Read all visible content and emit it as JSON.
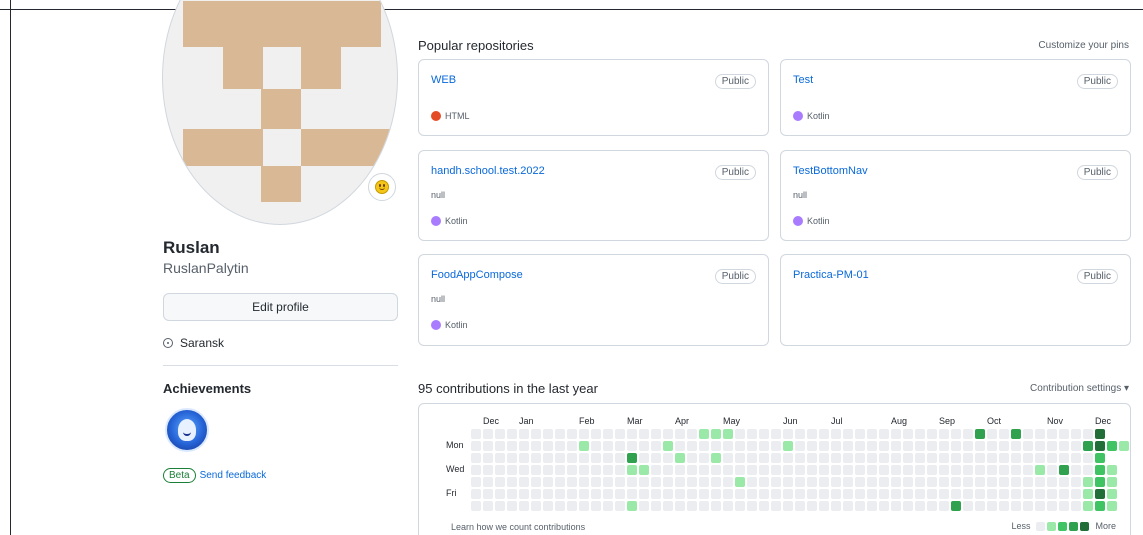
{
  "profile": {
    "name": "Ruslan",
    "login": "RuslanPalytin",
    "edit_label": "Edit profile",
    "location": "Saransk",
    "achievements_title": "Achievements",
    "beta_label": "Beta",
    "feedback_label": "Send feedback"
  },
  "repos": {
    "title": "Popular repositories",
    "customize_label": "Customize your pins",
    "items": [
      {
        "name": "WEB",
        "visibility": "Public",
        "description": "",
        "language": "HTML",
        "color": "#e34c26"
      },
      {
        "name": "Test",
        "visibility": "Public",
        "description": "",
        "language": "Kotlin",
        "color": "#A97BFF"
      },
      {
        "name": "handh.school.test.2022",
        "visibility": "Public",
        "description": "null",
        "language": "Kotlin",
        "color": "#A97BFF"
      },
      {
        "name": "TestBottomNav",
        "visibility": "Public",
        "description": "null",
        "language": "Kotlin",
        "color": "#A97BFF"
      },
      {
        "name": "FoodAppCompose",
        "visibility": "Public",
        "description": "null",
        "language": "Kotlin",
        "color": "#A97BFF"
      },
      {
        "name": "Practica-PM-01",
        "visibility": "Public",
        "description": "",
        "language": "",
        "color": ""
      }
    ]
  },
  "contributions": {
    "title": "95 contributions in the last year",
    "settings_label": "Contribution settings ▾",
    "months": [
      "Dec",
      "Jan",
      "Feb",
      "Mar",
      "Apr",
      "May",
      "Jun",
      "Jul",
      "Aug",
      "Sep",
      "Oct",
      "Nov",
      "Dec"
    ],
    "month_week_index": [
      1,
      4,
      9,
      13,
      17,
      21,
      26,
      30,
      35,
      39,
      43,
      48,
      52
    ],
    "day_labels": [
      "Mon",
      "Wed",
      "Fri"
    ],
    "day_label_rows": [
      1,
      3,
      5
    ],
    "learn_label": "Learn how we count contributions",
    "legend_less": "Less",
    "legend_more": "More",
    "level_colors": [
      "#ebedf0",
      "#9be9a8",
      "#40c463",
      "#30a14e",
      "#216e39"
    ],
    "active_cells": [
      [
        9,
        1,
        1
      ],
      [
        13,
        2,
        3
      ],
      [
        14,
        3,
        1
      ],
      [
        13,
        3,
        1
      ],
      [
        16,
        1,
        1
      ],
      [
        17,
        2,
        1
      ],
      [
        19,
        0,
        1
      ],
      [
        20,
        0,
        1
      ],
      [
        21,
        0,
        1
      ],
      [
        20,
        2,
        1
      ],
      [
        22,
        4,
        1
      ],
      [
        13,
        6,
        1
      ],
      [
        26,
        1,
        1
      ],
      [
        40,
        6,
        3
      ],
      [
        42,
        0,
        3
      ],
      [
        45,
        0,
        3
      ],
      [
        47,
        3,
        1
      ],
      [
        49,
        3,
        3
      ],
      [
        52,
        0,
        4
      ],
      [
        51,
        1,
        3
      ],
      [
        52,
        1,
        4
      ],
      [
        53,
        1,
        2
      ],
      [
        54,
        1,
        1
      ],
      [
        52,
        2,
        2
      ],
      [
        52,
        3,
        2
      ],
      [
        53,
        3,
        1
      ],
      [
        51,
        4,
        1
      ],
      [
        52,
        4,
        2
      ],
      [
        53,
        4,
        1
      ],
      [
        52,
        5,
        4
      ],
      [
        53,
        5,
        1
      ],
      [
        51,
        6,
        1
      ],
      [
        52,
        6,
        2
      ],
      [
        53,
        6,
        1
      ],
      [
        51,
        5,
        1
      ]
    ]
  }
}
